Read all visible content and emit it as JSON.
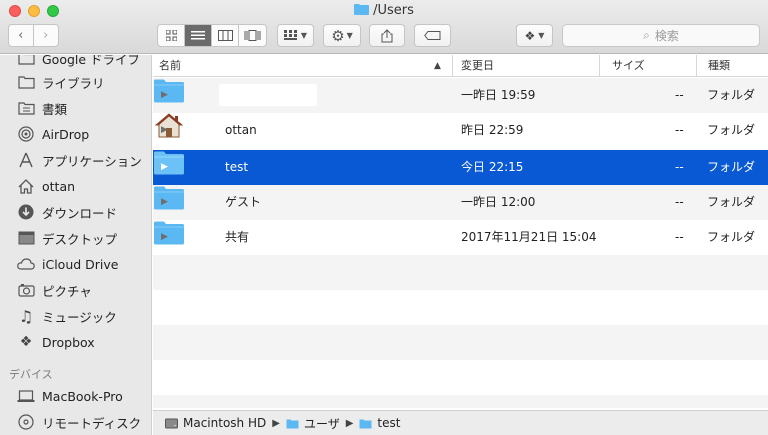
{
  "window": {
    "title": "/Users"
  },
  "toolbar": {
    "search_placeholder": "検索"
  },
  "sidebar": {
    "favorites": [
      {
        "label": "Google ドライブ",
        "icon": "folder-icon"
      },
      {
        "label": "ライブラリ",
        "icon": "folder-icon"
      },
      {
        "label": "書類",
        "icon": "document-icon"
      },
      {
        "label": "AirDrop",
        "icon": "airdrop-icon"
      },
      {
        "label": "アプリケーション",
        "icon": "applications-icon"
      },
      {
        "label": "ottan",
        "icon": "home-icon"
      },
      {
        "label": "ダウンロード",
        "icon": "download-icon"
      },
      {
        "label": "デスクトップ",
        "icon": "desktop-icon"
      },
      {
        "label": "iCloud Drive",
        "icon": "cloud-icon"
      },
      {
        "label": "ピクチャ",
        "icon": "camera-icon"
      },
      {
        "label": "ミュージック",
        "icon": "music-icon"
      },
      {
        "label": "Dropbox",
        "icon": "dropbox-icon"
      }
    ],
    "devices_header": "デバイス",
    "devices": [
      {
        "label": "MacBook-Pro",
        "icon": "laptop-icon"
      },
      {
        "label": "リモートディスク",
        "icon": "disc-icon"
      }
    ]
  },
  "columns": {
    "name": "名前",
    "modified": "変更日",
    "size": "サイズ",
    "kind": "種類"
  },
  "files": [
    {
      "name": "",
      "modified": "一昨日 19:59",
      "size": "--",
      "kind": "フォルダ",
      "icon": "folder-icon"
    },
    {
      "name": "ottan",
      "modified": "昨日 22:59",
      "size": "--",
      "kind": "フォルダ",
      "icon": "home-folder-icon"
    },
    {
      "name": "test",
      "modified": "今日 22:15",
      "size": "--",
      "kind": "フォルダ",
      "icon": "folder-icon",
      "selected": true
    },
    {
      "name": "ゲスト",
      "modified": "一昨日 12:00",
      "size": "--",
      "kind": "フォルダ",
      "icon": "folder-icon"
    },
    {
      "name": "共有",
      "modified": "2017年11月21日 15:04",
      "size": "--",
      "kind": "フォルダ",
      "icon": "folder-icon"
    }
  ],
  "path": [
    "Macintosh HD",
    "ユーザ",
    "test"
  ],
  "colors": {
    "selection": "#0a59d4",
    "folder": "#5cb8f2"
  }
}
